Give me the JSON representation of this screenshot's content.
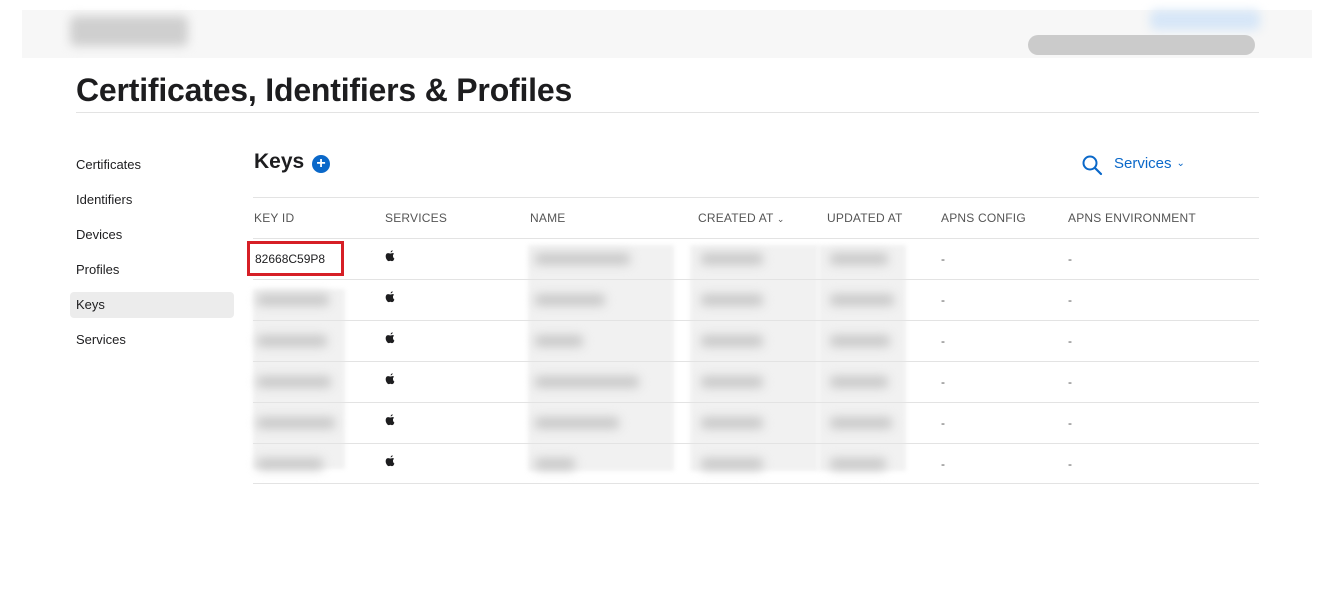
{
  "page": {
    "title": "Certificates, Identifiers & Profiles"
  },
  "sidebar": {
    "items": [
      {
        "label": "Certificates",
        "active": false
      },
      {
        "label": "Identifiers",
        "active": false
      },
      {
        "label": "Devices",
        "active": false
      },
      {
        "label": "Profiles",
        "active": false
      },
      {
        "label": "Keys",
        "active": true
      },
      {
        "label": "Services",
        "active": false
      }
    ]
  },
  "section": {
    "title": "Keys",
    "add_icon": "plus-circle-icon",
    "search_icon": "search-icon",
    "filter_label": "Services"
  },
  "table": {
    "columns": [
      "KEY ID",
      "SERVICES",
      "NAME",
      "CREATED AT",
      "UPDATED AT",
      "APNS CONFIG",
      "APNS ENVIRONMENT"
    ],
    "sorted_column": "CREATED AT",
    "rows": [
      {
        "key_id": "82668C59P8",
        "service_icon": "apple-icon",
        "apns_config": "-",
        "apns_environment": "-"
      },
      {
        "key_id": "",
        "service_icon": "apple-icon",
        "apns_config": "-",
        "apns_environment": "-"
      },
      {
        "key_id": "",
        "service_icon": "apple-icon",
        "apns_config": "-",
        "apns_environment": "-"
      },
      {
        "key_id": "",
        "service_icon": "apple-icon",
        "apns_config": "-",
        "apns_environment": "-"
      },
      {
        "key_id": "",
        "service_icon": "apple-icon",
        "apns_config": "-",
        "apns_environment": "-"
      },
      {
        "key_id": "",
        "service_icon": "apple-icon",
        "apns_config": "-",
        "apns_environment": "-"
      }
    ]
  },
  "colors": {
    "accent": "#0a68c9",
    "highlight": "#d61f26",
    "active_sidebar_bg": "#ececec"
  }
}
